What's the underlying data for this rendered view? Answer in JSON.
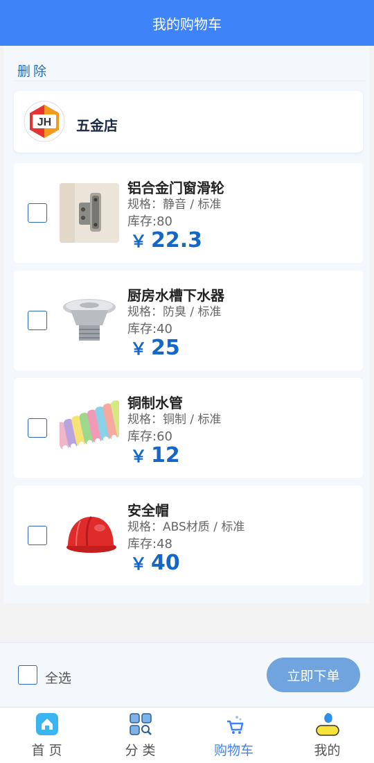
{
  "header": {
    "title": "我的购物车"
  },
  "toolbar": {
    "delete_label": "删除"
  },
  "store": {
    "name": "五金店",
    "logo_text": "JH"
  },
  "items": [
    {
      "name": "铝合金门窗滑轮",
      "spec": "规格：静音 / 标准",
      "stock": "库存:80",
      "currency": "￥",
      "price": "22.3",
      "image": "hinge"
    },
    {
      "name": "厨房水槽下水器",
      "spec": "规格：防臭 / 标准",
      "stock": "库存:40",
      "currency": "￥",
      "price": "25",
      "image": "sink-drain"
    },
    {
      "name": "铜制水管",
      "spec": "规格：铜制 / 标准",
      "stock": "库存:60",
      "currency": "￥",
      "price": "12",
      "image": "colored-pipes"
    },
    {
      "name": "安全帽",
      "spec": "规格：ABS材质 / 标准",
      "stock": "库存:48",
      "currency": "￥",
      "price": "40",
      "image": "red-helmet"
    }
  ],
  "footer": {
    "select_all_label": "全选",
    "order_button_label": "立即下单"
  },
  "tabbar": {
    "tabs": [
      {
        "label": "首 页",
        "icon": "home-icon",
        "active": false
      },
      {
        "label": "分 类",
        "icon": "category-icon",
        "active": false
      },
      {
        "label": "购物车",
        "icon": "cart-icon",
        "active": true
      },
      {
        "label": "我的",
        "icon": "profile-icon",
        "active": false
      }
    ]
  },
  "colors": {
    "header": "#3f83f8",
    "price": "#1466c8",
    "order_button": "#6fa4df",
    "active_tab": "#3f83f8"
  }
}
